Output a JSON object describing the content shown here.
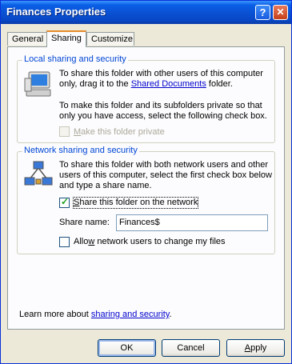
{
  "window": {
    "title": "Finances Properties",
    "help_glyph": "?",
    "close_glyph": "✕"
  },
  "tabs": [
    {
      "label": "General"
    },
    {
      "label": "Sharing"
    },
    {
      "label": "Customize"
    }
  ],
  "local": {
    "legend": "Local sharing and security",
    "text1_line1": "To share this folder with other users of this computer",
    "text1_line2_prefix": "only, drag it to the ",
    "text1_link": "Shared Documents",
    "text1_line2_suffix": " folder.",
    "text2_line1": "To make this folder and its subfolders private so that",
    "text2_line2": "only you have access, select the following check box.",
    "private_accel": "M",
    "private_rest": "ake this folder private"
  },
  "network": {
    "legend": "Network sharing and security",
    "text_line1": "To share this folder with both network users and other",
    "text_line2": "users of this computer, select the first check box below",
    "text_line3": "and type a share name.",
    "share_accel": "S",
    "share_rest": "hare this folder on the network",
    "share_name_label": "Share name:",
    "share_name_value": "Finances$",
    "allow_pre": "Allo",
    "allow_accel": "w",
    "allow_rest": " network users to change my files"
  },
  "footer": {
    "learn_prefix": "Learn more about ",
    "learn_link": "sharing and security",
    "learn_suffix": "."
  },
  "buttons": {
    "ok": "OK",
    "cancel": "Cancel",
    "apply_accel": "A",
    "apply_rest": "pply"
  }
}
